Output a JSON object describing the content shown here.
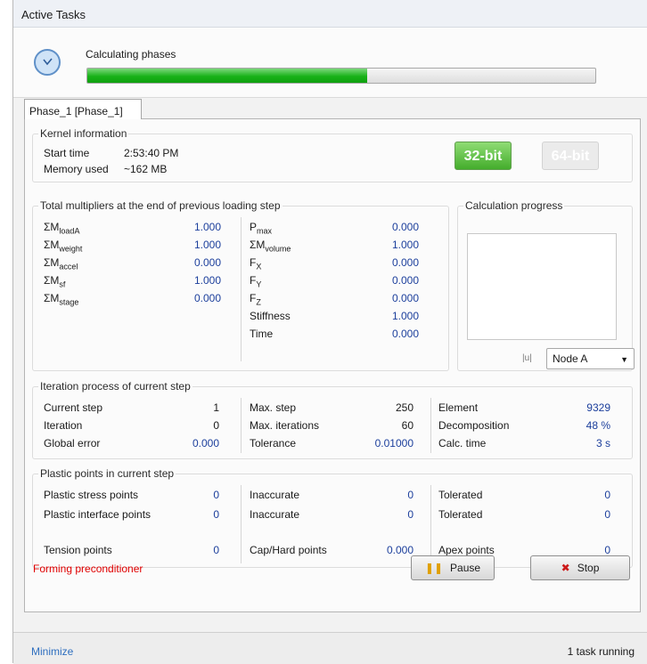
{
  "window": {
    "title": "Active Tasks"
  },
  "header": {
    "phase_label": "Calculating phases",
    "progress": 0.55
  },
  "tab": {
    "label": "Phase_1 [Phase_1]"
  },
  "kernel": {
    "title": "Kernel information",
    "start_time_label": "Start time",
    "start_time_value": "2:53:40 PM",
    "memory_label": "Memory used",
    "memory_value": "~162 MB",
    "bit32_label": "32-bit",
    "bit64_label": "64-bit"
  },
  "multipliers": {
    "title": "Total multipliers at the end of previous loading step",
    "left": [
      {
        "sym": "ΣM",
        "sub": "loadA",
        "value": "1.000"
      },
      {
        "sym": "ΣM",
        "sub": "weight",
        "value": "1.000"
      },
      {
        "sym": "ΣM",
        "sub": "accel",
        "value": "0.000"
      },
      {
        "sym": "ΣM",
        "sub": "sf",
        "value": "1.000"
      },
      {
        "sym": "ΣM",
        "sub": "stage",
        "value": "0.000"
      }
    ],
    "right": [
      {
        "sym": "P",
        "sub": "max",
        "value": "0.000"
      },
      {
        "sym": "ΣM",
        "sub": "volume",
        "value": "1.000"
      },
      {
        "sym": "F",
        "sub": "X",
        "value": "0.000"
      },
      {
        "sym": "F",
        "sub": "Y",
        "value": "0.000"
      },
      {
        "sym": "F",
        "sub": "Z",
        "value": "0.000"
      },
      {
        "sym": "Stiffness",
        "sub": "",
        "value": "1.000"
      },
      {
        "sym": "Time",
        "sub": "",
        "value": "0.000"
      }
    ]
  },
  "calc_progress": {
    "title": "Calculation progress",
    "u_icon": "|u|",
    "node_select": "Node A"
  },
  "iteration": {
    "title": "Iteration process of current step",
    "col1": [
      {
        "label": "Current step",
        "value": "1"
      },
      {
        "label": "Iteration",
        "value": "0"
      },
      {
        "label": "Global error",
        "value": "0.000"
      }
    ],
    "col2": [
      {
        "label": "Max. step",
        "value": "250"
      },
      {
        "label": "Max. iterations",
        "value": "60"
      },
      {
        "label": "Tolerance",
        "value": "0.01000"
      }
    ],
    "col3": [
      {
        "label": "Element",
        "value": "9329"
      },
      {
        "label": "Decomposition",
        "value": "48 %"
      },
      {
        "label": "Calc. time",
        "value": "3 s"
      }
    ]
  },
  "plastic": {
    "title": "Plastic points in current step",
    "col1": [
      {
        "label": "Plastic stress points",
        "value": "0"
      },
      {
        "label": "Plastic interface points",
        "value": "0"
      },
      {
        "label": "Tension points",
        "value": "0"
      }
    ],
    "col2": [
      {
        "label": "Inaccurate",
        "value": "0"
      },
      {
        "label": "Inaccurate",
        "value": "0"
      },
      {
        "label": "Cap/Hard points",
        "value": "0.000"
      }
    ],
    "col3": [
      {
        "label": "Tolerated",
        "value": "0"
      },
      {
        "label": "Tolerated",
        "value": "0"
      },
      {
        "label": "Apex points",
        "value": "0"
      }
    ]
  },
  "status": {
    "text": "Forming preconditioner",
    "color": "#e00000"
  },
  "buttons": {
    "pause": "Pause",
    "stop": "Stop"
  },
  "footer": {
    "minimize": "Minimize",
    "task_count": "1 task running"
  },
  "icons": {
    "clock": "clock-icon",
    "pause": "pause-icon",
    "stop": "stop-icon"
  }
}
